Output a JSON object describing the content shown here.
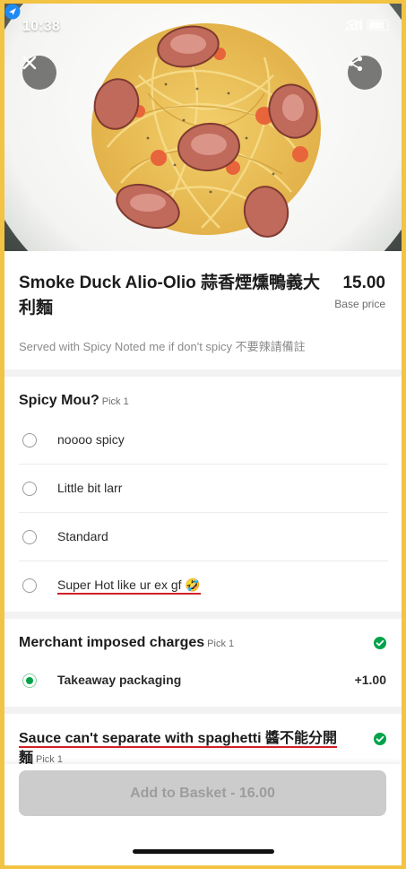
{
  "status_bar": {
    "time": "10:38"
  },
  "item": {
    "title": "Smoke Duck Alio-Olio 蒜香煙燻鴨義大利麵",
    "price": "15.00",
    "price_caption": "Base price",
    "description": "Served with Spicy Noted me if don't spicy 不要辣請備註"
  },
  "sections": [
    {
      "title": "Spicy Mou?",
      "pick": "Pick 1",
      "options": [
        {
          "label": "noooo spicy"
        },
        {
          "label": "Little bit larr"
        },
        {
          "label": "Standard"
        },
        {
          "label": "Super Hot like ur ex gf 🤣"
        }
      ]
    },
    {
      "title": "Merchant imposed charges",
      "pick": "Pick 1",
      "options": [
        {
          "label": "Takeaway packaging",
          "price": "+1.00",
          "selected": true
        }
      ]
    },
    {
      "title": "Sauce can't separate with spaghetti 醬不能分開",
      "title_wrap": "麵",
      "pick": "Pick 1"
    }
  ],
  "footer": {
    "button_label": "Add to Basket - 16.00"
  },
  "colors": {
    "accent_green": "#00a34a",
    "frame": "#f3c343",
    "annotation_red": "#d31f27",
    "disabled_button": "#cccccc"
  },
  "icons": [
    "location-arrow-icon",
    "close-icon",
    "share-icon",
    "check-circle-icon"
  ]
}
